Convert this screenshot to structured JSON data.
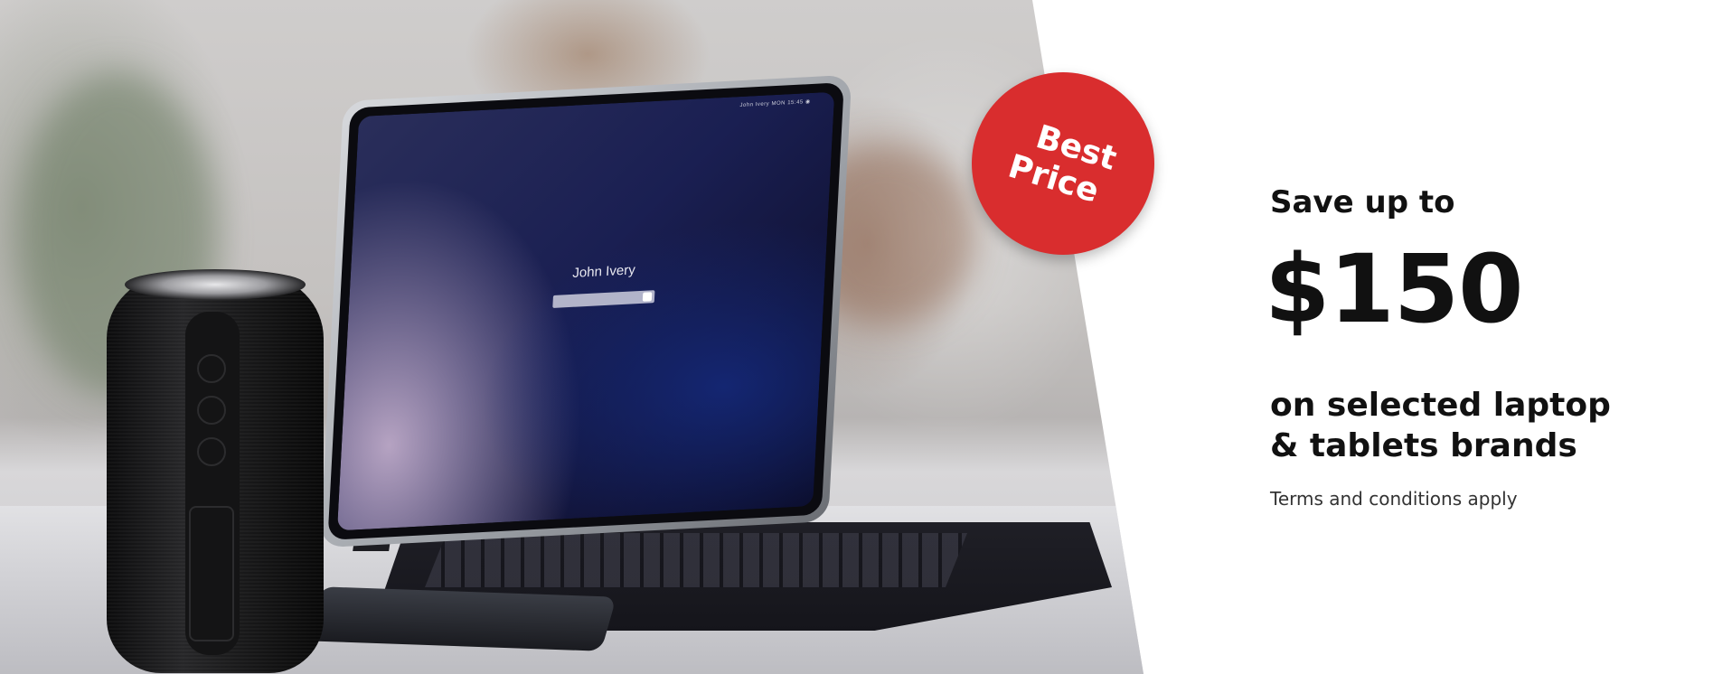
{
  "photo": {
    "screen_username": "John Ivery",
    "screen_status": "John Ivery  MON  15:45  ◉"
  },
  "badge": {
    "line1": "Best",
    "line2": "Price",
    "color": "#d92d2e"
  },
  "promo": {
    "kicker": "Save up to",
    "amount": "$150",
    "desc_line1": "on selected laptop",
    "desc_line2": "& tablets brands",
    "terms": "Terms and conditions apply"
  }
}
